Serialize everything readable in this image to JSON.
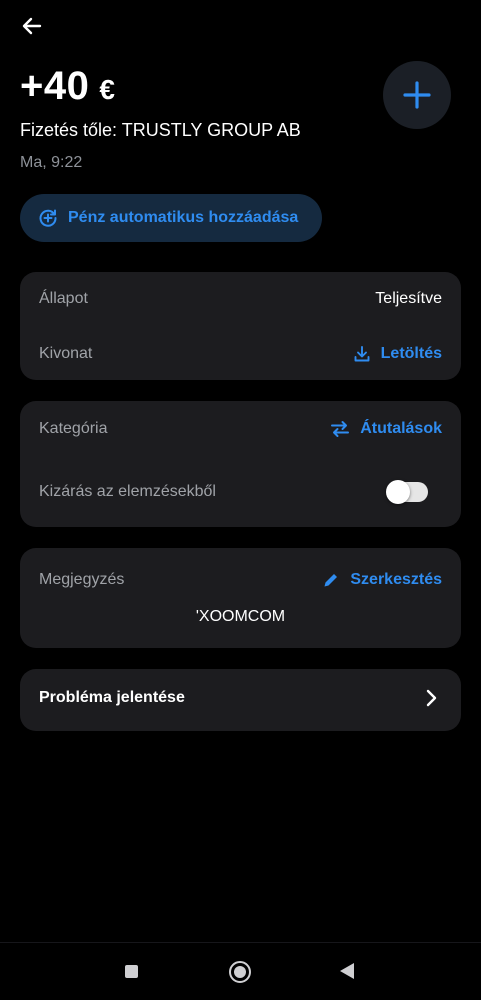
{
  "header": {
    "back_icon": "arrow-left-icon",
    "amount": "+40",
    "currency": "€",
    "add_icon": "plus-icon",
    "payer": "Fizetés tőle: TRUSTLY GROUP AB",
    "time": "Ma, 9:22"
  },
  "auto_add": {
    "icon": "add-circle-icon",
    "label": "Pénz automatikus hozzáadása"
  },
  "status_card": {
    "status_label": "Állapot",
    "status_value": "Teljesítve",
    "statement_label": "Kivonat",
    "download_icon": "download-icon",
    "download_label": "Letöltés"
  },
  "category_card": {
    "category_label": "Kategória",
    "transfer_icon": "swap-arrows-icon",
    "category_value": "Átutalások",
    "exclude_label": "Kizárás az elemzésekből",
    "exclude_enabled": false
  },
  "note_card": {
    "note_label": "Megjegyzés",
    "edit_icon": "pencil-icon",
    "edit_label": "Szerkesztés",
    "note_text": "'XOOMCOM"
  },
  "report": {
    "label": "Probléma jelentése",
    "icon": "chevron-right-icon"
  },
  "colors": {
    "background": "#000000",
    "card": "#1c1c1f",
    "accent": "#2f8cf0",
    "secondary_text": "#a0a3a8"
  }
}
